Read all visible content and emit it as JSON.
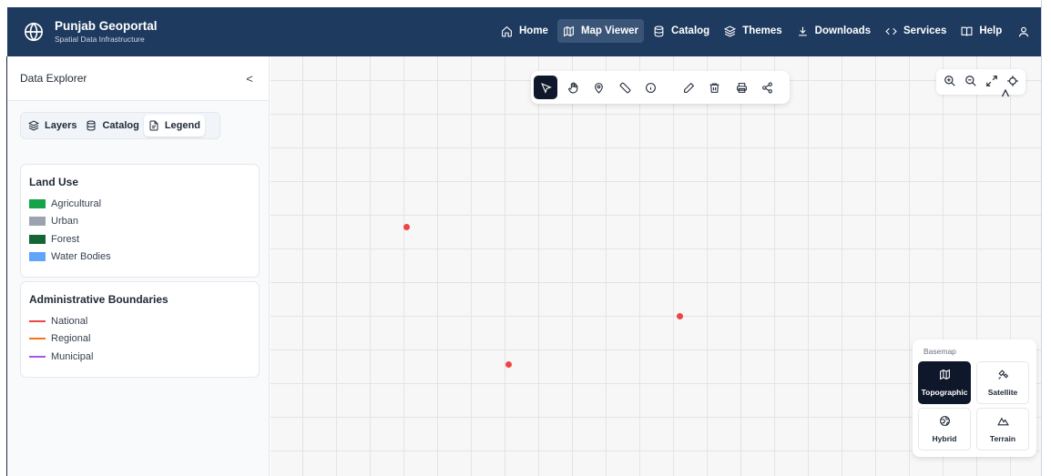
{
  "app": {
    "title": "Punjab Geoportal",
    "subtitle": "Spatial Data Infrastructure",
    "logo_icon": "globe-icon"
  },
  "nav": [
    {
      "label": "Home",
      "icon": "home-icon",
      "active": false
    },
    {
      "label": "Map Viewer",
      "icon": "map-icon",
      "active": true
    },
    {
      "label": "Catalog",
      "icon": "database-icon",
      "active": false
    },
    {
      "label": "Themes",
      "icon": "layers-icon",
      "active": false
    },
    {
      "label": "Downloads",
      "icon": "download-icon",
      "active": false
    },
    {
      "label": "Services",
      "icon": "code-icon",
      "active": false
    },
    {
      "label": "Help",
      "icon": "book-icon",
      "active": false
    }
  ],
  "user_icon": "user-icon",
  "sidebar": {
    "title": "Data Explorer",
    "collapse_glyph": "<",
    "tabs": [
      {
        "label": "Layers",
        "icon": "layers-icon",
        "active": false
      },
      {
        "label": "Catalog",
        "icon": "database-icon",
        "active": false
      },
      {
        "label": "Legend",
        "icon": "file-text-icon",
        "active": true
      }
    ]
  },
  "legend": {
    "land_use": {
      "title": "Land Use",
      "items": [
        {
          "label": "Agricultural",
          "color": "#16a34a"
        },
        {
          "label": "Urban",
          "color": "#9ca3af"
        },
        {
          "label": "Forest",
          "color": "#166534"
        },
        {
          "label": "Water Bodies",
          "color": "#60a5fa"
        }
      ]
    },
    "boundaries": {
      "title": "Administrative Boundaries",
      "items": [
        {
          "label": "National",
          "color": "#ef4444"
        },
        {
          "label": "Regional",
          "color": "#f97316"
        },
        {
          "label": "Municipal",
          "color": "#a855f7"
        }
      ]
    }
  },
  "toolbar": [
    {
      "name": "select",
      "icon": "pointer-icon",
      "active": true
    },
    {
      "name": "pan",
      "icon": "hand-icon",
      "active": false
    },
    {
      "name": "marker",
      "icon": "map-pin-icon",
      "active": false
    },
    {
      "name": "measure",
      "icon": "ruler-icon",
      "active": false
    },
    {
      "name": "info",
      "icon": "info-icon",
      "active": false
    },
    {
      "name": "draw",
      "icon": "pencil-icon",
      "active": false
    },
    {
      "name": "delete",
      "icon": "trash-icon",
      "active": false
    },
    {
      "name": "print",
      "icon": "printer-icon",
      "active": false
    },
    {
      "name": "share",
      "icon": "share-icon",
      "active": false
    }
  ],
  "map_controls": [
    "zoom-in-icon",
    "zoom-out-icon",
    "fullscreen-icon",
    "locate-icon"
  ],
  "basemap": {
    "label": "Basemap",
    "options": [
      {
        "label": "Topographic",
        "icon": "map-icon",
        "active": true
      },
      {
        "label": "Satellite",
        "icon": "satellite-icon",
        "active": false
      },
      {
        "label": "Hybrid",
        "icon": "globe-icon",
        "active": false
      },
      {
        "label": "Terrain",
        "icon": "mountain-icon",
        "active": false
      }
    ]
  },
  "colors": {
    "header": "#1e3a5f",
    "accent_active": "#0f172a",
    "marker": "#ef4444"
  }
}
